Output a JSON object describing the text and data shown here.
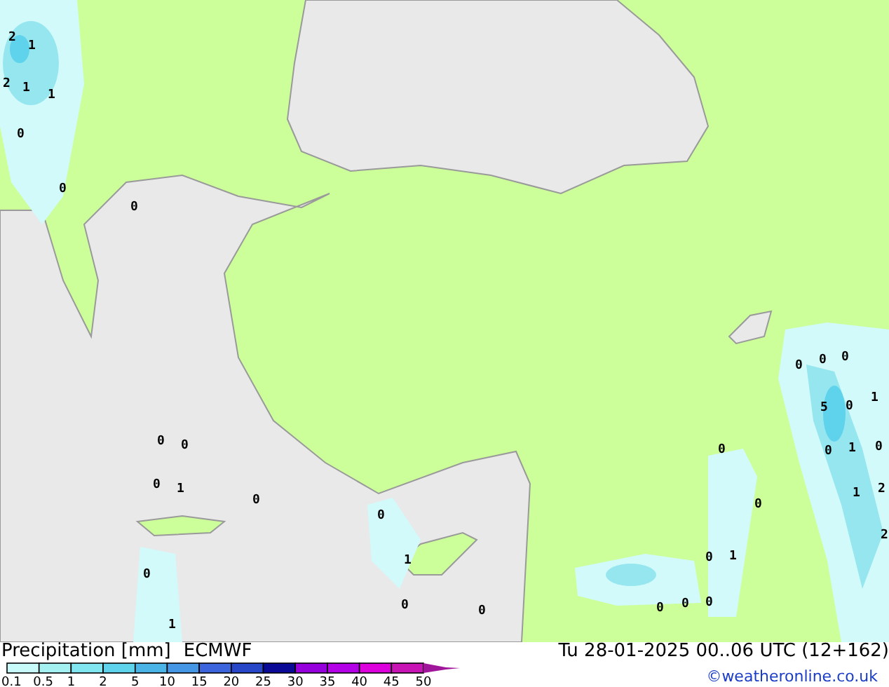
{
  "map": {
    "labels": [
      {
        "text": "2"
      },
      {
        "text": "1"
      },
      {
        "text": "2"
      },
      {
        "text": "1"
      },
      {
        "text": "1"
      },
      {
        "text": "0"
      },
      {
        "text": "0"
      },
      {
        "text": "0"
      },
      {
        "text": "0"
      },
      {
        "text": "0"
      },
      {
        "text": "0"
      },
      {
        "text": "1"
      },
      {
        "text": "0"
      },
      {
        "text": "0"
      },
      {
        "text": "1"
      },
      {
        "text": "0"
      },
      {
        "text": "1"
      },
      {
        "text": "0"
      },
      {
        "text": "0"
      },
      {
        "text": "0"
      },
      {
        "text": "0"
      },
      {
        "text": "0"
      },
      {
        "text": "0"
      },
      {
        "text": "1"
      },
      {
        "text": "0"
      },
      {
        "text": "0"
      },
      {
        "text": "0"
      },
      {
        "text": "0"
      },
      {
        "text": "0"
      },
      {
        "text": "1"
      },
      {
        "text": "5"
      },
      {
        "text": "0"
      },
      {
        "text": "0"
      },
      {
        "text": "1"
      },
      {
        "text": "0"
      },
      {
        "text": "1"
      },
      {
        "text": "2"
      },
      {
        "text": "2"
      }
    ]
  },
  "legend": {
    "title": "Precipitation [mm]",
    "model": "ECMWF",
    "bins": [
      {
        "color": "#c8fafa"
      },
      {
        "color": "#a5f0f0"
      },
      {
        "color": "#82e6f0"
      },
      {
        "color": "#5fd2ec"
      },
      {
        "color": "#4bb4e6"
      },
      {
        "color": "#4696e6"
      },
      {
        "color": "#3c64dc"
      },
      {
        "color": "#2846c8"
      },
      {
        "color": "#0a0a96"
      },
      {
        "color": "#9600dc"
      },
      {
        "color": "#b400e6"
      },
      {
        "color": "#dc00dc"
      },
      {
        "color": "#c814b4"
      }
    ],
    "ticks": [
      "0.1",
      "0.5",
      "1",
      "2",
      "5",
      "10",
      "15",
      "20",
      "25",
      "30",
      "35",
      "40",
      "45",
      "50"
    ]
  },
  "valid_time": "Tu 28-01-2025 00..06 UTC (12+162)",
  "credit": "©weatheronline.co.uk"
}
